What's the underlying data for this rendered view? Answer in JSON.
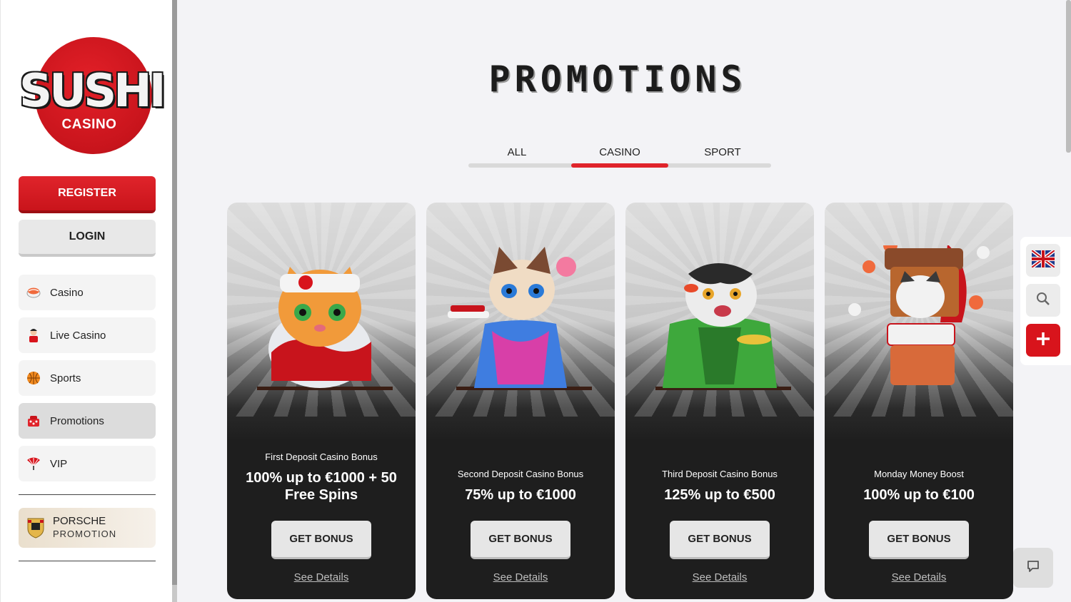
{
  "logo": {
    "word": "SUSHI",
    "sub": "CASINO"
  },
  "auth": {
    "register": "REGISTER",
    "login": "LOGIN"
  },
  "nav": [
    {
      "label": "Casino",
      "icon": "sushi-icon"
    },
    {
      "label": "Live Casino",
      "icon": "dealer-icon"
    },
    {
      "label": "Sports",
      "icon": "basketball-icon"
    },
    {
      "label": "Promotions",
      "icon": "gift-icon"
    },
    {
      "label": "VIP",
      "icon": "fan-icon"
    }
  ],
  "porsche": {
    "line1": "PORSCHE",
    "line2": "PROMOTION"
  },
  "page": {
    "title": "PROMOTIONS"
  },
  "tabs": [
    {
      "label": "ALL"
    },
    {
      "label": "CASINO",
      "active": true
    },
    {
      "label": "SPORT"
    }
  ],
  "cards": [
    {
      "subtitle": "First Deposit Casino Bonus",
      "headline": "100% up to €1000 + 50 Free Spins",
      "button": "GET BONUS",
      "link": "See Details"
    },
    {
      "subtitle": "Second Deposit Casino Bonus",
      "headline": "75% up to €1000",
      "button": "GET BONUS",
      "link": "See Details"
    },
    {
      "subtitle": "Third Deposit Casino Bonus",
      "headline": "125% up to €500",
      "button": "GET BONUS",
      "link": "See Details"
    },
    {
      "subtitle": "Monday Money Boost",
      "headline": "100% up to €100",
      "button": "GET BONUS",
      "link": "See Details"
    }
  ],
  "colors": {
    "accent": "#e0242b",
    "card_dark": "#1e1e1e",
    "sidebar": "#ffffff",
    "background": "#f3f3f6"
  }
}
